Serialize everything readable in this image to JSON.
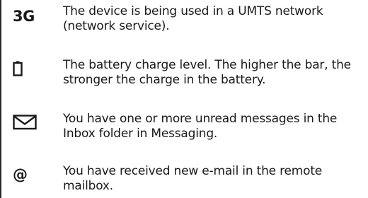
{
  "entries": [
    {
      "icon": "3g-network-icon",
      "symbol_text": "3G",
      "text": "The device is being used in a UMTS network (network service)."
    },
    {
      "icon": "battery-icon",
      "text": "The battery charge level. The higher the bar, the stronger the charge in the battery."
    },
    {
      "icon": "envelope-icon",
      "text": "You have one or more unread messages in the Inbox folder in Messaging."
    },
    {
      "icon": "at-sign-icon",
      "symbol_text": "@",
      "text": "You have received new e-mail in the remote mailbox."
    }
  ]
}
